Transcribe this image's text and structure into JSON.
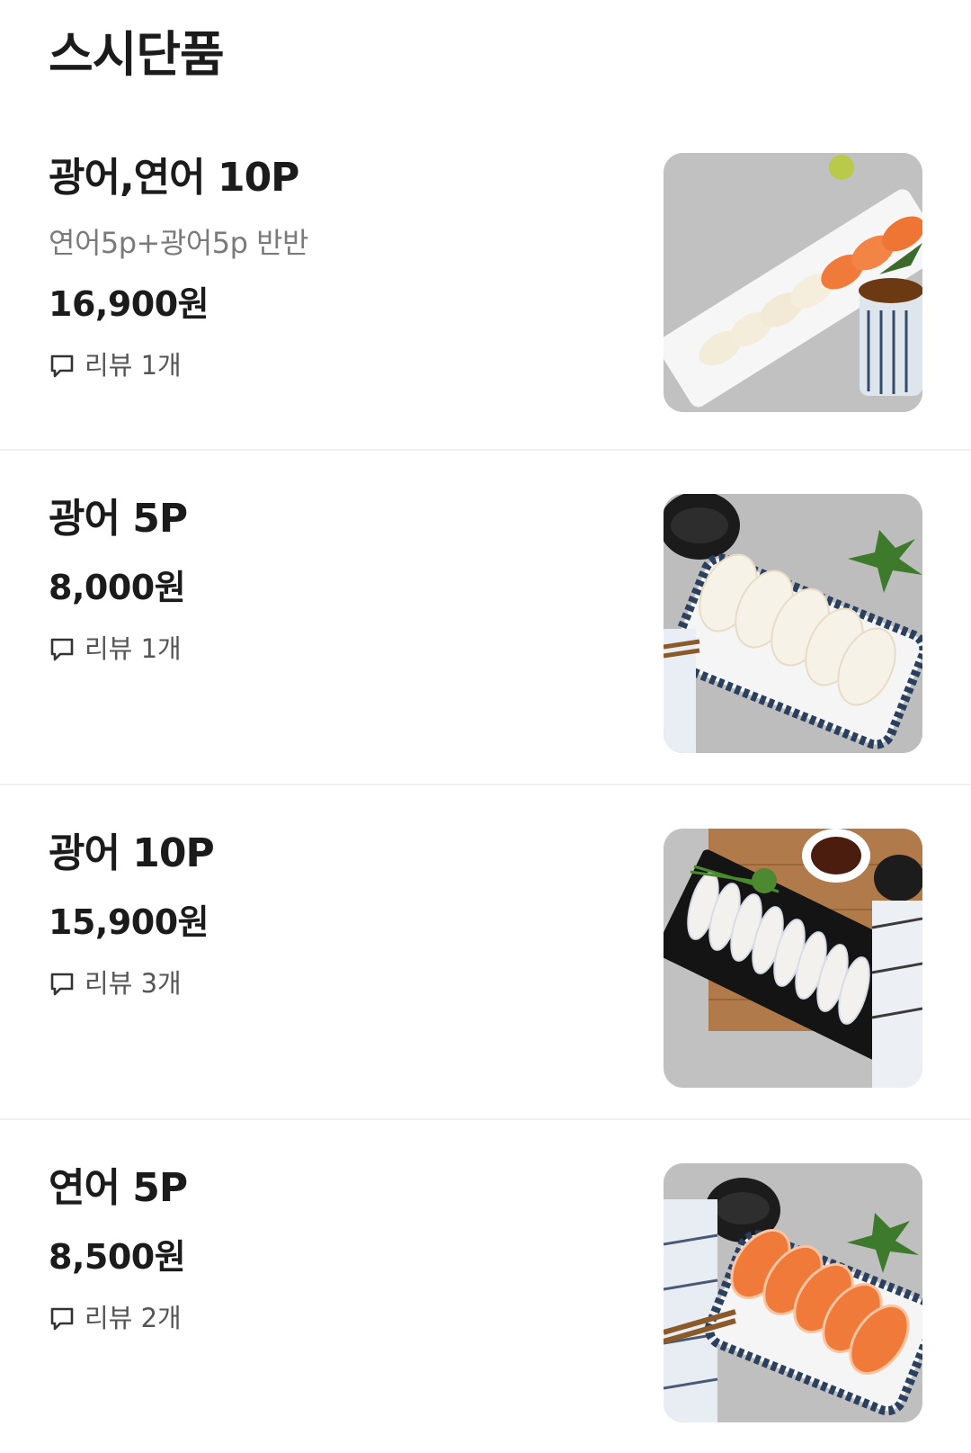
{
  "section": {
    "title": "스시단품"
  },
  "items": [
    {
      "name": "광어,연어 10P",
      "description": "연어5p+광어5p 반반",
      "price": "16,900원",
      "review": "리뷰 1개",
      "image": "sushi-platter-halibut-salmon-photo"
    },
    {
      "name": "광어 5P",
      "price": "8,000원",
      "review": "리뷰 1개",
      "image": "halibut-sushi-5-photo"
    },
    {
      "name": "광어 10P",
      "price": "15,900원",
      "review": "리뷰 3개",
      "image": "halibut-sushi-10-photo"
    },
    {
      "name": "연어 5P",
      "price": "8,500원",
      "review": "리뷰 2개",
      "image": "salmon-sushi-5-photo"
    }
  ],
  "icons": {
    "review": "speech-bubble-icon"
  },
  "colors": {
    "text": "#1b1b1b",
    "description": "#7a7a7a",
    "review": "#555555",
    "divider": "#f0f0f0",
    "salmon": "#f07a3a",
    "halibut": "#f4efe3"
  }
}
